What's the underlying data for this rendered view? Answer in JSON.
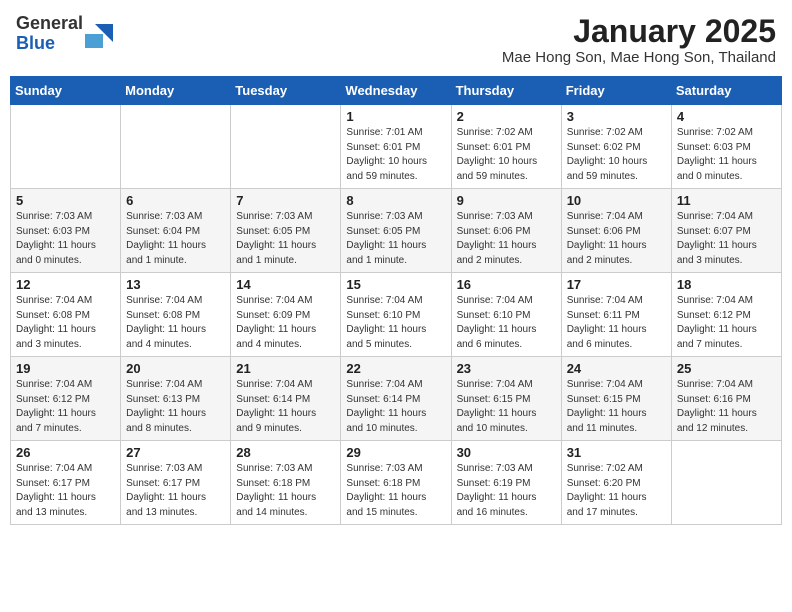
{
  "logo": {
    "general": "General",
    "blue": "Blue"
  },
  "title": "January 2025",
  "subtitle": "Mae Hong Son, Mae Hong Son, Thailand",
  "days_of_week": [
    "Sunday",
    "Monday",
    "Tuesday",
    "Wednesday",
    "Thursday",
    "Friday",
    "Saturday"
  ],
  "weeks": [
    [
      {
        "day": "",
        "info": ""
      },
      {
        "day": "",
        "info": ""
      },
      {
        "day": "",
        "info": ""
      },
      {
        "day": "1",
        "info": "Sunrise: 7:01 AM\nSunset: 6:01 PM\nDaylight: 10 hours\nand 59 minutes."
      },
      {
        "day": "2",
        "info": "Sunrise: 7:02 AM\nSunset: 6:01 PM\nDaylight: 10 hours\nand 59 minutes."
      },
      {
        "day": "3",
        "info": "Sunrise: 7:02 AM\nSunset: 6:02 PM\nDaylight: 10 hours\nand 59 minutes."
      },
      {
        "day": "4",
        "info": "Sunrise: 7:02 AM\nSunset: 6:03 PM\nDaylight: 11 hours\nand 0 minutes."
      }
    ],
    [
      {
        "day": "5",
        "info": "Sunrise: 7:03 AM\nSunset: 6:03 PM\nDaylight: 11 hours\nand 0 minutes."
      },
      {
        "day": "6",
        "info": "Sunrise: 7:03 AM\nSunset: 6:04 PM\nDaylight: 11 hours\nand 1 minute."
      },
      {
        "day": "7",
        "info": "Sunrise: 7:03 AM\nSunset: 6:05 PM\nDaylight: 11 hours\nand 1 minute."
      },
      {
        "day": "8",
        "info": "Sunrise: 7:03 AM\nSunset: 6:05 PM\nDaylight: 11 hours\nand 1 minute."
      },
      {
        "day": "9",
        "info": "Sunrise: 7:03 AM\nSunset: 6:06 PM\nDaylight: 11 hours\nand 2 minutes."
      },
      {
        "day": "10",
        "info": "Sunrise: 7:04 AM\nSunset: 6:06 PM\nDaylight: 11 hours\nand 2 minutes."
      },
      {
        "day": "11",
        "info": "Sunrise: 7:04 AM\nSunset: 6:07 PM\nDaylight: 11 hours\nand 3 minutes."
      }
    ],
    [
      {
        "day": "12",
        "info": "Sunrise: 7:04 AM\nSunset: 6:08 PM\nDaylight: 11 hours\nand 3 minutes."
      },
      {
        "day": "13",
        "info": "Sunrise: 7:04 AM\nSunset: 6:08 PM\nDaylight: 11 hours\nand 4 minutes."
      },
      {
        "day": "14",
        "info": "Sunrise: 7:04 AM\nSunset: 6:09 PM\nDaylight: 11 hours\nand 4 minutes."
      },
      {
        "day": "15",
        "info": "Sunrise: 7:04 AM\nSunset: 6:10 PM\nDaylight: 11 hours\nand 5 minutes."
      },
      {
        "day": "16",
        "info": "Sunrise: 7:04 AM\nSunset: 6:10 PM\nDaylight: 11 hours\nand 6 minutes."
      },
      {
        "day": "17",
        "info": "Sunrise: 7:04 AM\nSunset: 6:11 PM\nDaylight: 11 hours\nand 6 minutes."
      },
      {
        "day": "18",
        "info": "Sunrise: 7:04 AM\nSunset: 6:12 PM\nDaylight: 11 hours\nand 7 minutes."
      }
    ],
    [
      {
        "day": "19",
        "info": "Sunrise: 7:04 AM\nSunset: 6:12 PM\nDaylight: 11 hours\nand 7 minutes."
      },
      {
        "day": "20",
        "info": "Sunrise: 7:04 AM\nSunset: 6:13 PM\nDaylight: 11 hours\nand 8 minutes."
      },
      {
        "day": "21",
        "info": "Sunrise: 7:04 AM\nSunset: 6:14 PM\nDaylight: 11 hours\nand 9 minutes."
      },
      {
        "day": "22",
        "info": "Sunrise: 7:04 AM\nSunset: 6:14 PM\nDaylight: 11 hours\nand 10 minutes."
      },
      {
        "day": "23",
        "info": "Sunrise: 7:04 AM\nSunset: 6:15 PM\nDaylight: 11 hours\nand 10 minutes."
      },
      {
        "day": "24",
        "info": "Sunrise: 7:04 AM\nSunset: 6:15 PM\nDaylight: 11 hours\nand 11 minutes."
      },
      {
        "day": "25",
        "info": "Sunrise: 7:04 AM\nSunset: 6:16 PM\nDaylight: 11 hours\nand 12 minutes."
      }
    ],
    [
      {
        "day": "26",
        "info": "Sunrise: 7:04 AM\nSunset: 6:17 PM\nDaylight: 11 hours\nand 13 minutes."
      },
      {
        "day": "27",
        "info": "Sunrise: 7:03 AM\nSunset: 6:17 PM\nDaylight: 11 hours\nand 13 minutes."
      },
      {
        "day": "28",
        "info": "Sunrise: 7:03 AM\nSunset: 6:18 PM\nDaylight: 11 hours\nand 14 minutes."
      },
      {
        "day": "29",
        "info": "Sunrise: 7:03 AM\nSunset: 6:18 PM\nDaylight: 11 hours\nand 15 minutes."
      },
      {
        "day": "30",
        "info": "Sunrise: 7:03 AM\nSunset: 6:19 PM\nDaylight: 11 hours\nand 16 minutes."
      },
      {
        "day": "31",
        "info": "Sunrise: 7:02 AM\nSunset: 6:20 PM\nDaylight: 11 hours\nand 17 minutes."
      },
      {
        "day": "",
        "info": ""
      }
    ]
  ]
}
